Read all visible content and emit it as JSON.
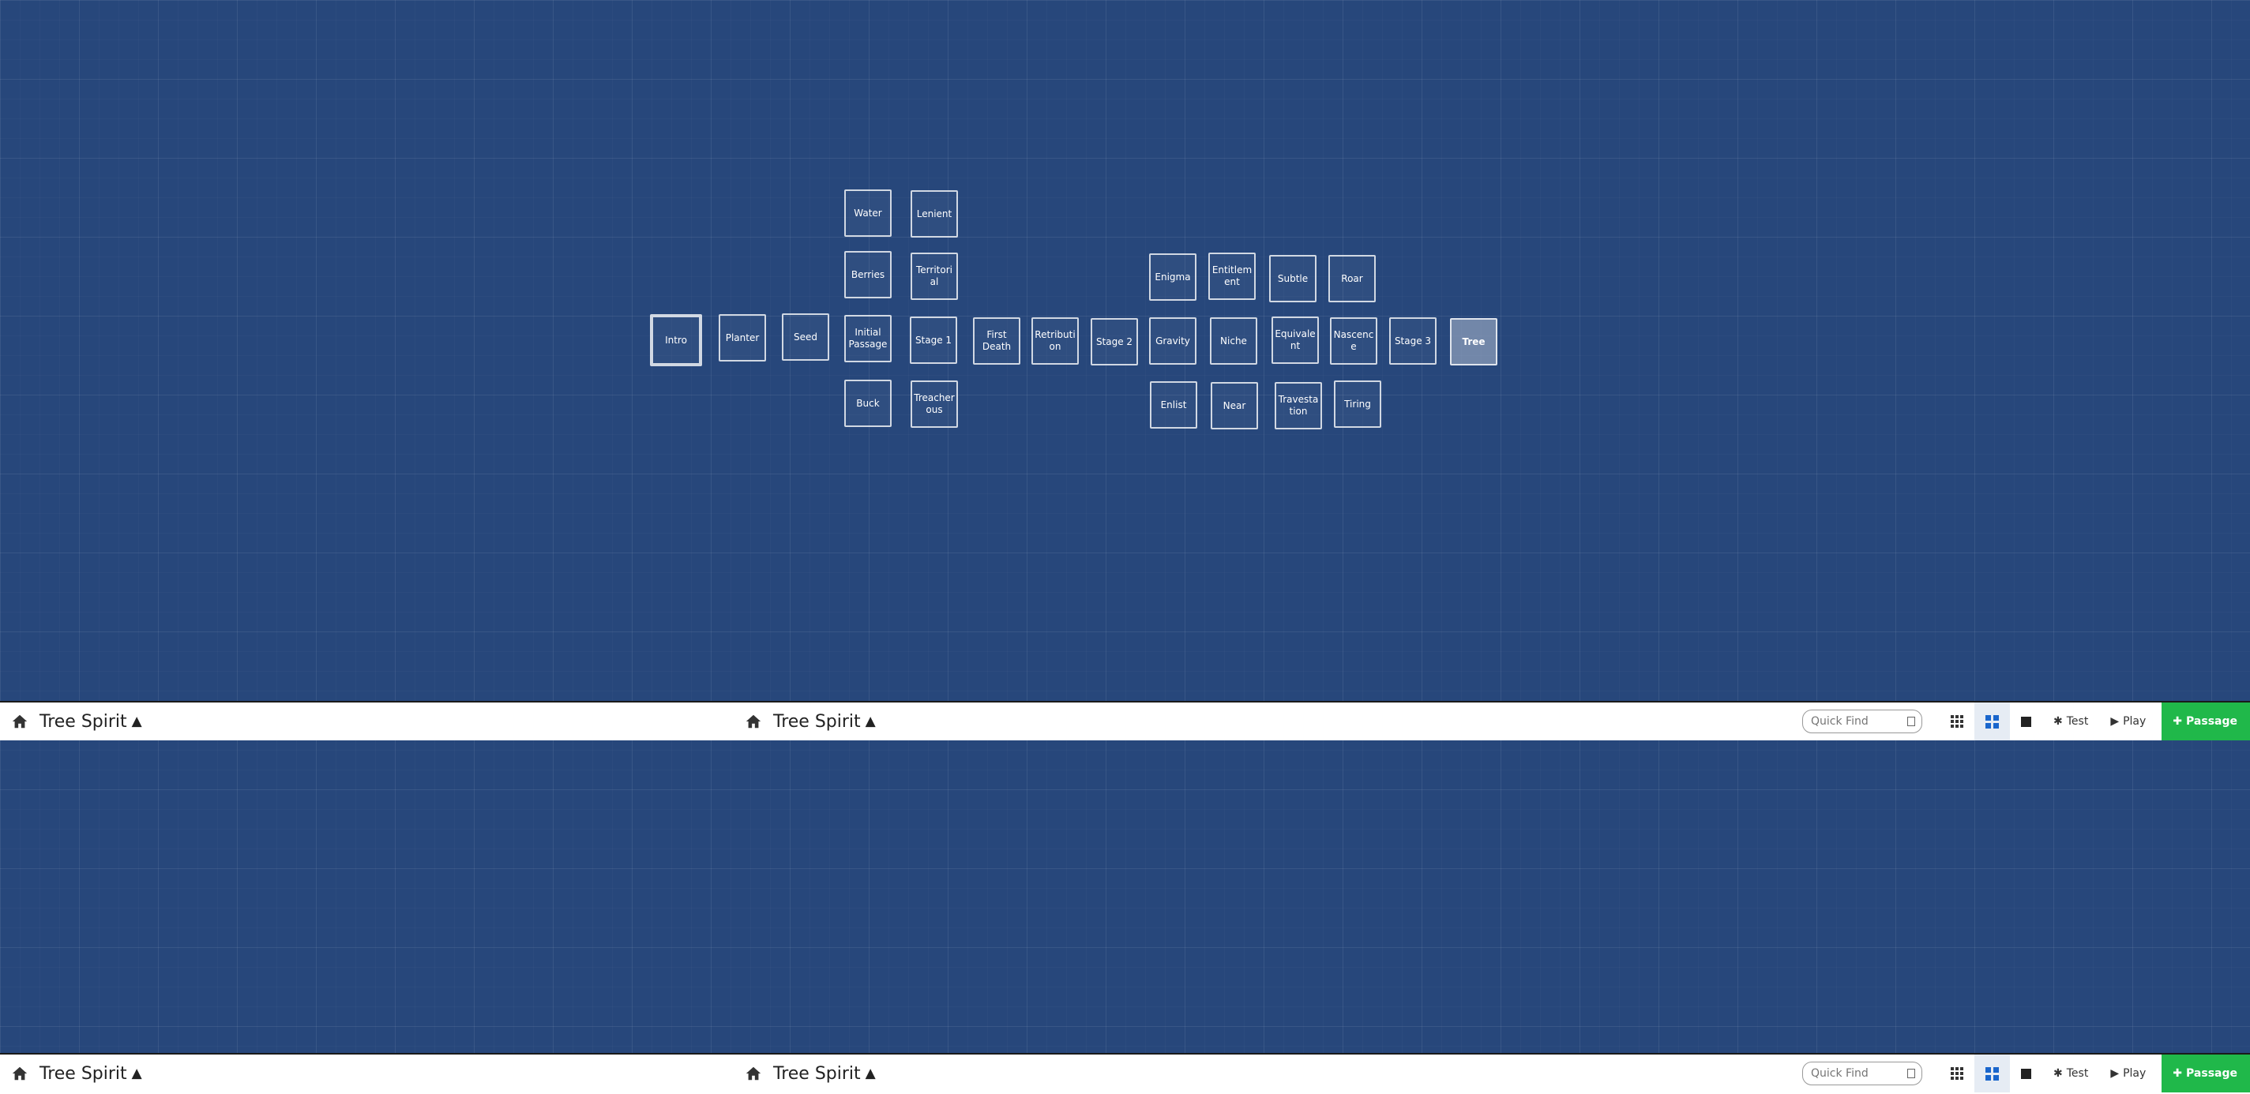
{
  "story": {
    "title": "Tree Spirit"
  },
  "passages": [
    {
      "id": "water",
      "label": "Water"
    },
    {
      "id": "lenient",
      "label": "Lenient"
    },
    {
      "id": "berries",
      "label": "Berries"
    },
    {
      "id": "territorial",
      "label": "Territorial"
    },
    {
      "id": "intro",
      "label": "Intro",
      "start": true
    },
    {
      "id": "planter",
      "label": "Planter"
    },
    {
      "id": "seed",
      "label": "Seed"
    },
    {
      "id": "initial-passage",
      "label": "Initial Passage"
    },
    {
      "id": "stage-1",
      "label": "Stage 1"
    },
    {
      "id": "first-death",
      "label": "First Death"
    },
    {
      "id": "retribution",
      "label": "Retribution"
    },
    {
      "id": "stage-2",
      "label": "Stage 2"
    },
    {
      "id": "buck",
      "label": "Buck"
    },
    {
      "id": "treacherous",
      "label": "Treacherous"
    },
    {
      "id": "enigma",
      "label": "Enigma"
    },
    {
      "id": "entitlement",
      "label": "Entitlement"
    },
    {
      "id": "subtle",
      "label": "Subtle"
    },
    {
      "id": "roar",
      "label": "Roar"
    },
    {
      "id": "gravity",
      "label": "Gravity"
    },
    {
      "id": "niche",
      "label": "Niche"
    },
    {
      "id": "equivalent",
      "label": "Equivalent"
    },
    {
      "id": "nascence",
      "label": "Nascence"
    },
    {
      "id": "stage-3",
      "label": "Stage 3"
    },
    {
      "id": "tree",
      "label": "Tree",
      "selected": true
    },
    {
      "id": "enlist",
      "label": "Enlist"
    },
    {
      "id": "near",
      "label": "Near"
    },
    {
      "id": "travestation",
      "label": "Travestation"
    },
    {
      "id": "tiring",
      "label": "Tiring"
    }
  ],
  "toolbar": {
    "quick_find_placeholder": "Quick Find",
    "test_label": "Test",
    "play_label": "Play",
    "add_passage_label": "Passage"
  },
  "icons": {
    "home": "home-icon",
    "title_menu": "caret-up-icon",
    "calendar": "calendar-icon",
    "zoom_small": "grid-small-icon",
    "zoom_medium": "grid-medium-icon",
    "zoom_large": "square-icon",
    "test": "bug-icon",
    "play": "play-icon",
    "add": "plus-icon"
  },
  "colors": {
    "canvas_bg": "#27477b",
    "add_button_bg": "#20b84a",
    "active_zoom": "#1a66cc"
  }
}
